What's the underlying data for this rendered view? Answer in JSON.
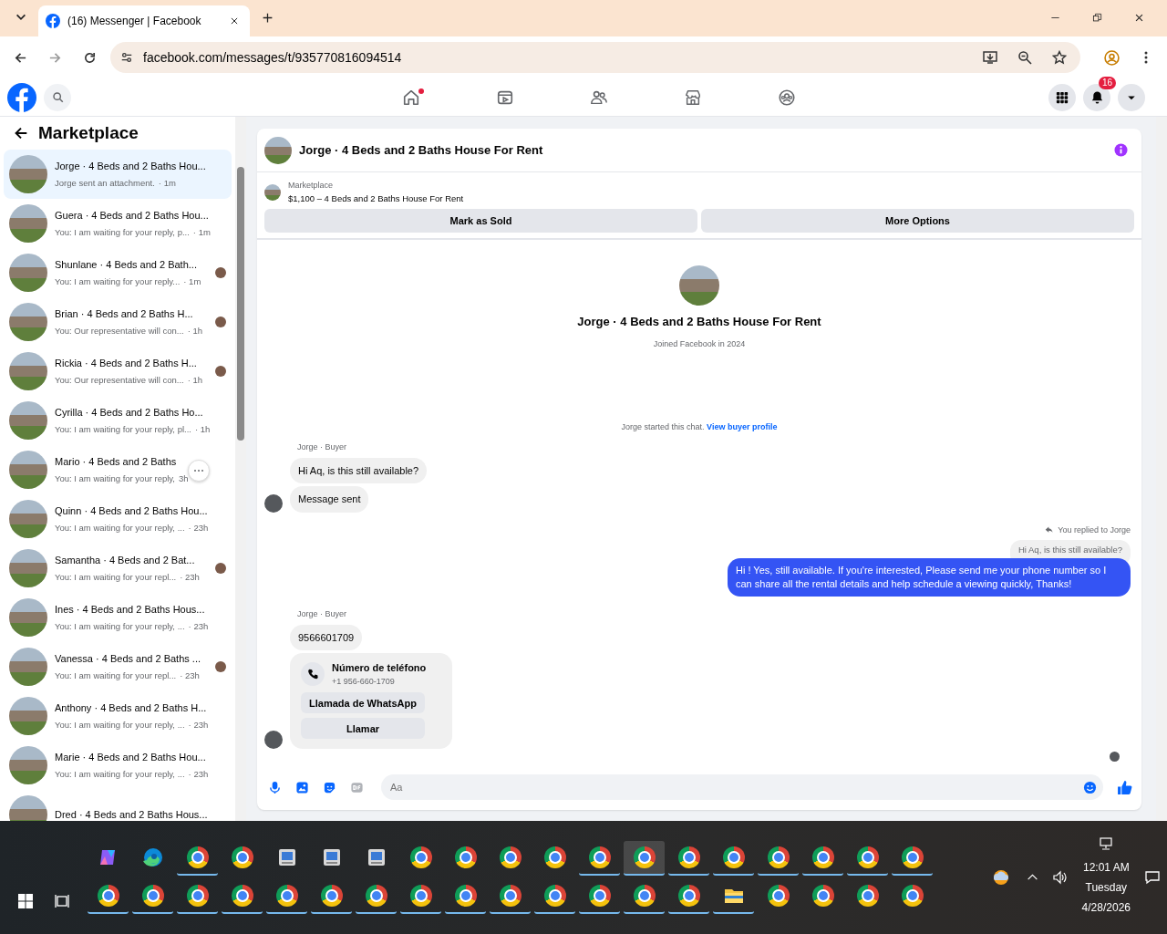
{
  "browser": {
    "tab_title": "(16) Messenger | Facebook",
    "url": "facebook.com/messages/t/935770816094514"
  },
  "top_nav": {
    "tabs": [
      {
        "kind": "home",
        "selected": false,
        "dot": true
      },
      {
        "kind": "video",
        "selected": false,
        "dot": false
      },
      {
        "kind": "friends",
        "selected": false,
        "dot": false
      },
      {
        "kind": "marketplace",
        "selected": false,
        "dot": false
      },
      {
        "kind": "groups",
        "selected": false,
        "dot": false
      }
    ],
    "notifications_badge": "16"
  },
  "sidebar": {
    "title": "Marketplace",
    "conversations": [
      {
        "name": "Jorge · 4 Beds and 2 Baths Hou...",
        "preview": "Jorge sent an attachment.",
        "time": "· 1m",
        "selected": true,
        "seen": false
      },
      {
        "name": "Guera · 4 Beds and 2 Baths Hou...",
        "preview": "You: I am waiting for your reply, p...",
        "time": "· 1m",
        "selected": false,
        "seen": false
      },
      {
        "name": "Shunlane · 4 Beds and 2 Bath...",
        "preview": "You: I am waiting for your reply...",
        "time": "· 1m",
        "selected": false,
        "seen": true
      },
      {
        "name": "Brian · 4 Beds and 2 Baths H...",
        "preview": "You: Our representative will con...",
        "time": "· 1h",
        "selected": false,
        "seen": true
      },
      {
        "name": "Rickia · 4 Beds and 2 Baths H...",
        "preview": "You: Our representative will con...",
        "time": "· 1h",
        "selected": false,
        "seen": true
      },
      {
        "name": "Cyrilla · 4 Beds and 2 Baths Ho...",
        "preview": "You: I am waiting for your reply, pl...",
        "time": "· 1h",
        "selected": false,
        "seen": false
      },
      {
        "name": "Mario · 4 Beds and 2 Baths",
        "preview": "You: I am waiting for your reply,",
        "time": "3h",
        "selected": false,
        "seen": false,
        "more_button": true
      },
      {
        "name": "Quinn · 4 Beds and 2 Baths Hou...",
        "preview": "You: I am waiting for your reply, ...",
        "time": "· 23h",
        "selected": false,
        "seen": false
      },
      {
        "name": "Samantha · 4 Beds and 2 Bat...",
        "preview": "You: I am waiting for your repl...",
        "time": "· 23h",
        "selected": false,
        "seen": true
      },
      {
        "name": "Ines · 4 Beds and 2 Baths Hous...",
        "preview": "You: I am waiting for your reply, ...",
        "time": "· 23h",
        "selected": false,
        "seen": false
      },
      {
        "name": "Vanessa · 4 Beds and 2 Baths ...",
        "preview": "You: I am waiting for your repl...",
        "time": "· 23h",
        "selected": false,
        "seen": true
      },
      {
        "name": "Anthony · 4 Beds and 2 Baths H...",
        "preview": "You: I am waiting for your reply, ...",
        "time": "· 23h",
        "selected": false,
        "seen": false
      },
      {
        "name": "Marie · 4 Beds and 2 Baths Hou...",
        "preview": "You: I am waiting for your reply, ...",
        "time": "· 23h",
        "selected": false,
        "seen": false
      },
      {
        "name": "Dred · 4 Beds and 2 Baths Hous...",
        "selected": false,
        "seen": false
      }
    ]
  },
  "chat": {
    "title": "Jorge · 4 Beds and 2 Baths House For Rent",
    "listing": {
      "source": "Marketplace",
      "title": "$1,100 – 4 Beds and 2 Baths House For Rent",
      "buttons": [
        "Mark as Sold",
        "More Options"
      ]
    },
    "profile": {
      "name": "Jorge · 4 Beds and 2 Baths House For Rent",
      "joined": "Joined Facebook in 2024"
    },
    "started": {
      "text": "Jorge started this chat.",
      "link": "View buyer profile"
    },
    "messages": [
      {
        "kind": "incoming",
        "sender": "Jorge · Buyer",
        "text": "Hi Aq, is this still available?",
        "avatar": false
      },
      {
        "kind": "incoming",
        "text": "Message sent",
        "avatar": true
      },
      {
        "kind": "outgoing",
        "reply_label": "You replied to Jorge",
        "quoted": "Hi Aq, is this still available?",
        "text": "Hi ! Yes, still available. If you're interested, Please send me your phone number so I can share all the rental details and help schedule a viewing quickly, Thanks!"
      },
      {
        "kind": "incoming",
        "sender": "Jorge · Buyer",
        "text": "9566601709",
        "avatar": false
      },
      {
        "kind": "contact",
        "title": "Número de teléfono",
        "phone": "+1 956-660-1709",
        "actions": [
          "Llamada de WhatsApp",
          "Llamar"
        ],
        "avatar": true
      }
    ],
    "seen": true,
    "composer": {
      "placeholder": "Aa"
    }
  },
  "taskbar": {
    "row_1": [
      {
        "kind": "copilot",
        "running": false,
        "active": false
      },
      {
        "kind": "edge",
        "running": false,
        "active": false
      },
      {
        "kind": "browser",
        "running": true,
        "active": false
      },
      {
        "kind": "browser",
        "running": false,
        "active": false
      },
      {
        "kind": "app",
        "running": false,
        "active": false
      },
      {
        "kind": "app",
        "running": false,
        "active": false
      },
      {
        "kind": "app",
        "running": false,
        "active": false
      },
      {
        "kind": "browser",
        "running": false,
        "active": false
      },
      {
        "kind": "browser",
        "running": false,
        "active": false
      },
      {
        "kind": "browser",
        "running": false,
        "active": false
      },
      {
        "kind": "browser",
        "running": false,
        "active": false
      },
      {
        "kind": "browser",
        "running": true,
        "active": false
      },
      {
        "kind": "browser",
        "running": true,
        "active": true
      },
      {
        "kind": "browser",
        "running": true,
        "active": false
      },
      {
        "kind": "browser",
        "running": true,
        "active": false
      },
      {
        "kind": "browser",
        "running": true,
        "active": false
      },
      {
        "kind": "browser",
        "running": true,
        "active": false
      },
      {
        "kind": "browser",
        "running": true,
        "active": false
      },
      {
        "kind": "browser",
        "running": true,
        "active": false
      }
    ],
    "row_2": [
      {
        "kind": "browser",
        "running": true,
        "active": false
      },
      {
        "kind": "browser",
        "running": true,
        "active": false
      },
      {
        "kind": "browser",
        "running": true,
        "active": false
      },
      {
        "kind": "browser",
        "running": true,
        "active": false
      },
      {
        "kind": "browser",
        "running": true,
        "active": false
      },
      {
        "kind": "browser",
        "running": true,
        "active": false
      },
      {
        "kind": "browser",
        "running": true,
        "active": false
      },
      {
        "kind": "browser",
        "running": true,
        "active": false
      },
      {
        "kind": "browser",
        "running": true,
        "active": false
      },
      {
        "kind": "browser",
        "running": true,
        "active": false
      },
      {
        "kind": "browser",
        "running": true,
        "active": false
      },
      {
        "kind": "browser",
        "running": true,
        "active": false
      },
      {
        "kind": "browser",
        "running": true,
        "active": false
      },
      {
        "kind": "browser",
        "running": true,
        "active": false
      },
      {
        "kind": "folder",
        "running": true,
        "active": false
      },
      {
        "kind": "browser",
        "running": false,
        "active": false
      },
      {
        "kind": "browser",
        "running": false,
        "active": false
      },
      {
        "kind": "browser",
        "running": false,
        "active": false
      },
      {
        "kind": "browser",
        "running": false,
        "active": false
      }
    ],
    "time": "12:01 AM",
    "day": "Tuesday",
    "date": "4/28/2026"
  }
}
